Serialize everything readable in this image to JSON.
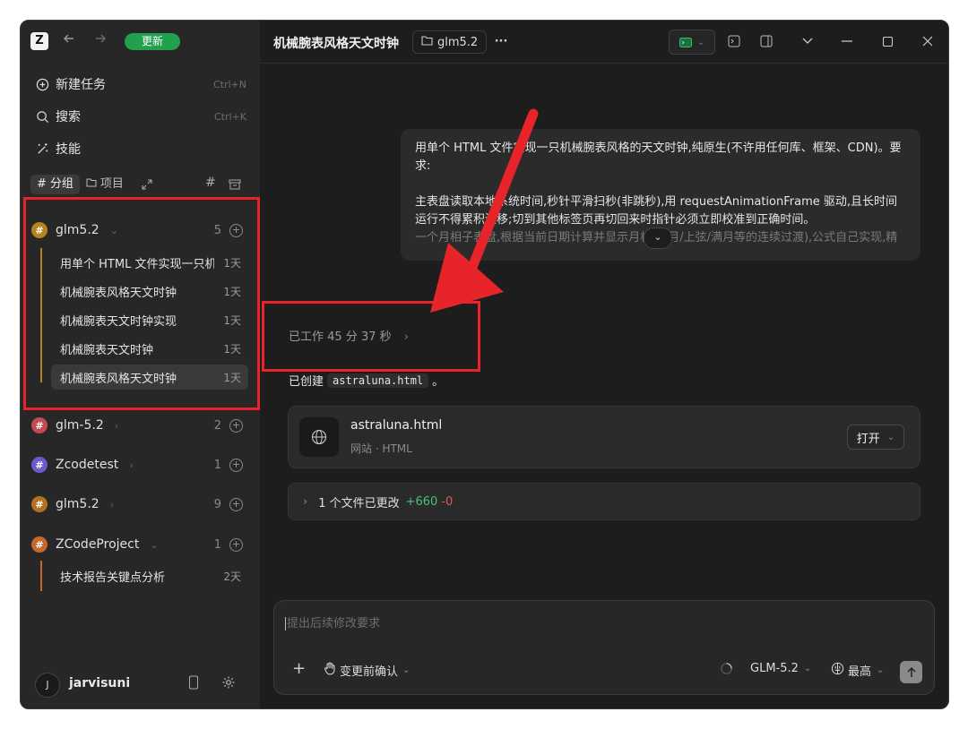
{
  "app": {
    "logo_letter": "Z",
    "update_label": "更新",
    "accent_green": "#23a04e",
    "annotation_red": "#e8242b"
  },
  "sidebar": {
    "menu": [
      {
        "label": "新建任务",
        "shortcut": "Ctrl+N",
        "icon": "plus-circle-icon"
      },
      {
        "label": "搜索",
        "shortcut": "Ctrl+K",
        "icon": "search-icon"
      },
      {
        "label": "技能",
        "shortcut": "",
        "icon": "magic-wand-icon"
      }
    ],
    "segments": [
      {
        "label": "分组",
        "icon": "hash-icon",
        "active": true
      },
      {
        "label": "项目",
        "icon": "folder-icon",
        "active": false
      }
    ],
    "groups": [
      {
        "name": "glm5.2",
        "count": "5",
        "color": "#b58220",
        "expanded": true,
        "tasks": [
          {
            "title": "用单个 HTML 文件实现一只机械腕表风格的天文时钟",
            "age": "1天"
          },
          {
            "title": "机械腕表风格天文时钟",
            "age": "1天"
          },
          {
            "title": "机械腕表天文时钟实现",
            "age": "1天"
          },
          {
            "title": "机械腕表天文时钟",
            "age": "1天"
          },
          {
            "title": "机械腕表风格天文时钟",
            "age": "1天",
            "selected": true
          }
        ]
      },
      {
        "name": "glm-5.2",
        "count": "2",
        "color": "#c44a52",
        "expanded": false
      },
      {
        "name": "Zcodetest",
        "count": "1",
        "color": "#6a5acd",
        "expanded": false
      },
      {
        "name": "glm5.2",
        "count": "9",
        "color": "#b5701f",
        "expanded": false
      },
      {
        "name": "ZCodeProject",
        "count": "1",
        "color": "#c26a2a",
        "expanded": true,
        "tasks": [
          {
            "title": "技术报告关键点分析",
            "age": "2天"
          }
        ]
      }
    ],
    "user": {
      "initial": "J",
      "name": "jarvisuni"
    }
  },
  "topbar": {
    "title": "机械腕表风格天文时钟",
    "folder": "glm5.2",
    "more": "···"
  },
  "chat": {
    "user_message": {
      "lines": [
        "用单个 HTML 文件实现一只机械腕表风格的天文时钟,纯原生(不许用任何库、框架、CDN)。要求:",
        "主表盘读取本地系统时间,秒针平滑扫秒(非跳秒),用 requestAnimationFrame 驱动,且长时间运行不得累积漂移;切到其他标签页再切回来时指针必须立即校准到正确时间。",
        "一个月相子表盘,根据当前日期计算并显示月相(新月/上弦/满月等的连续过渡),公式自己实现,精"
      ]
    },
    "worked_text": "已工作 45 分 37 秒",
    "created_prefix": "已创建",
    "created_file": "astraluna.html",
    "created_suffix": "。",
    "file_card": {
      "name": "astraluna.html",
      "meta": "网站 · HTML",
      "open_label": "打开"
    },
    "changes": {
      "label": "1 个文件已更改",
      "added": "+660",
      "removed": "-0"
    }
  },
  "composer": {
    "placeholder": "提出后续修改要求",
    "mode_label": "变更前确认",
    "model": "GLM-5.2",
    "effort": "最高"
  }
}
